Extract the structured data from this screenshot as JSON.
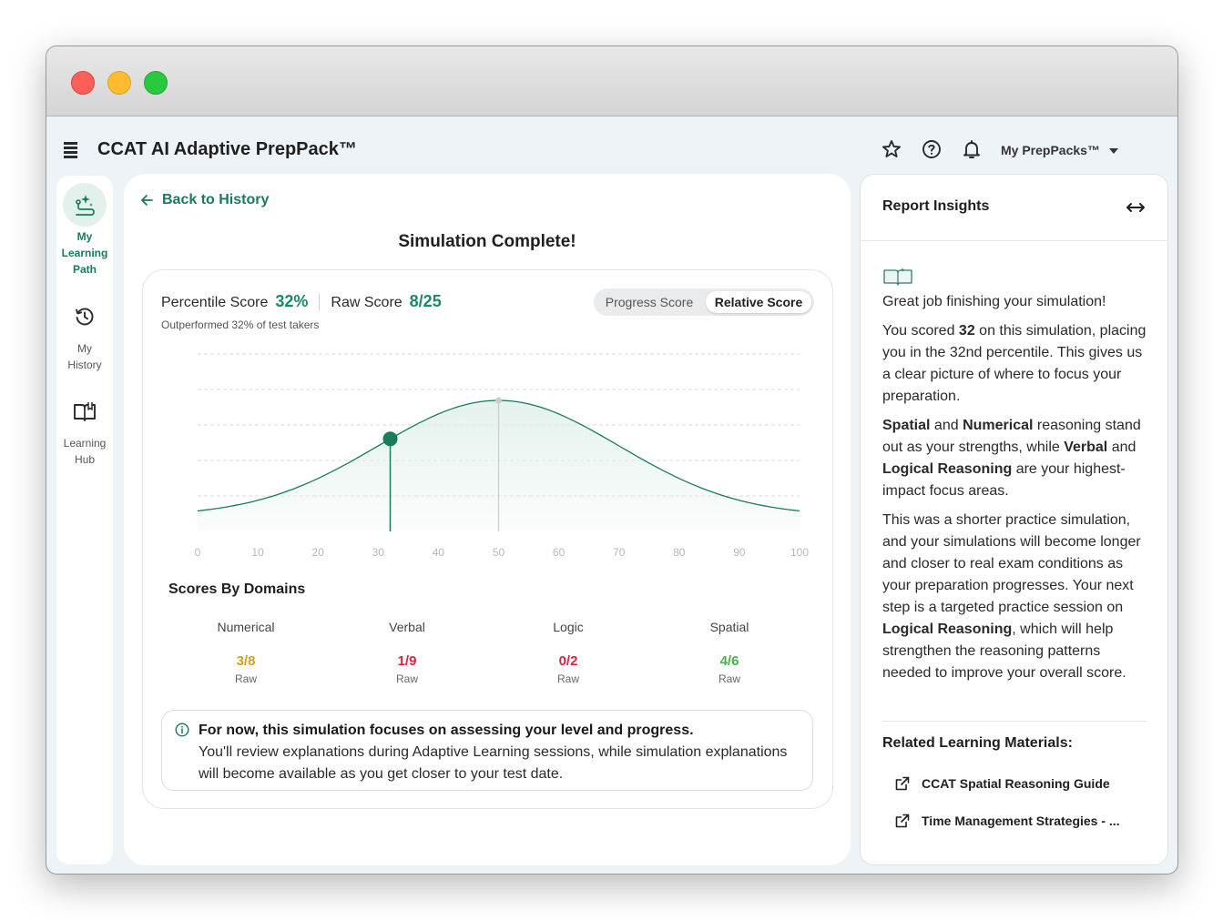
{
  "app": {
    "title": "CCAT AI Adaptive PrepPack™",
    "prep_menu_label": "My PrepPacks™",
    "icons": [
      "star-icon",
      "help-icon",
      "bell-icon"
    ]
  },
  "sidebar": {
    "items": [
      {
        "label": "My Learning Path",
        "lines": [
          "My",
          "Learning",
          "Path"
        ],
        "icon": "learning-path-icon",
        "active": true
      },
      {
        "label": "My History",
        "lines": [
          "My",
          "History"
        ],
        "icon": "history-icon",
        "active": false
      },
      {
        "label": "Learning Hub",
        "lines": [
          "Learning",
          "Hub"
        ],
        "icon": "book-icon",
        "active": false
      }
    ]
  },
  "main": {
    "back_label": "Back to History",
    "title": "Simulation Complete!",
    "percentile_label": "Percentile Score",
    "percentile_value": "32%",
    "raw_label": "Raw Score",
    "raw_value": "8/25",
    "outperformed_text": "Outperformed 32% of test takers",
    "toggle": {
      "options": [
        "Progress Score",
        "Relative Score"
      ],
      "selected": "Relative Score"
    },
    "domains_title": "Scores By Domains",
    "domains": [
      {
        "name": "Numerical",
        "score": "3/8",
        "unit": "Raw",
        "color": "#d4a017"
      },
      {
        "name": "Verbal",
        "score": "1/9",
        "unit": "Raw",
        "color": "#d7263d"
      },
      {
        "name": "Logic",
        "score": "0/2",
        "unit": "Raw",
        "color": "#d7263d"
      },
      {
        "name": "Spatial",
        "score": "4/6",
        "unit": "Raw",
        "color": "#4caf50"
      }
    ],
    "notice": {
      "bold": "For now, this simulation focuses on assessing your level and progress.",
      "text": "You'll review explanations during Adaptive Learning sessions, while simulation explanations will become available as you get closer to your test date."
    }
  },
  "chart_data": {
    "type": "area",
    "title": "",
    "xlabel": "",
    "ylabel": "",
    "xlim": [
      0,
      100
    ],
    "x_ticks": [
      0,
      10,
      20,
      30,
      40,
      50,
      60,
      70,
      80,
      90,
      100
    ],
    "distribution": "normal",
    "mean": 50,
    "marker": {
      "x": 32,
      "label": "Percentile Score"
    },
    "reference_line_x": 50,
    "grid": "horizontal dashed",
    "colors": {
      "line": "#1a7a5c",
      "fill": "#e3f1ec",
      "marker": "#1a7a5c",
      "reference": "#cccccc"
    }
  },
  "insights": {
    "title": "Report Insights",
    "intro": "Great job finishing your simulation!",
    "p1": {
      "pre": "You scored ",
      "bold": "32",
      "post": " on this simulation, placing you in the 32nd percentile. This gives us a clear picture of where to focus your preparation."
    },
    "p2": {
      "b1": "Spatial",
      "t1": " and ",
      "b2": "Numerical",
      "t2": " reasoning stand out as your strengths, while ",
      "b3": "Verbal",
      "t3": " and ",
      "b4": "Logical Reasoning",
      "t4": " are your highest-impact focus areas."
    },
    "p3": {
      "pre": "This was a shorter practice simulation, and your simulations will become longer and closer to real exam conditions as your preparation progresses. Your next step is a targeted practice session on ",
      "bold": "Logical Reasoning",
      "post": ", which will help strengthen the reasoning patterns needed to improve your overall score."
    },
    "related_title": "Related Learning Materials:",
    "related": [
      "CCAT Spatial Reasoning Guide",
      "Time Management Strategies - ..."
    ]
  }
}
